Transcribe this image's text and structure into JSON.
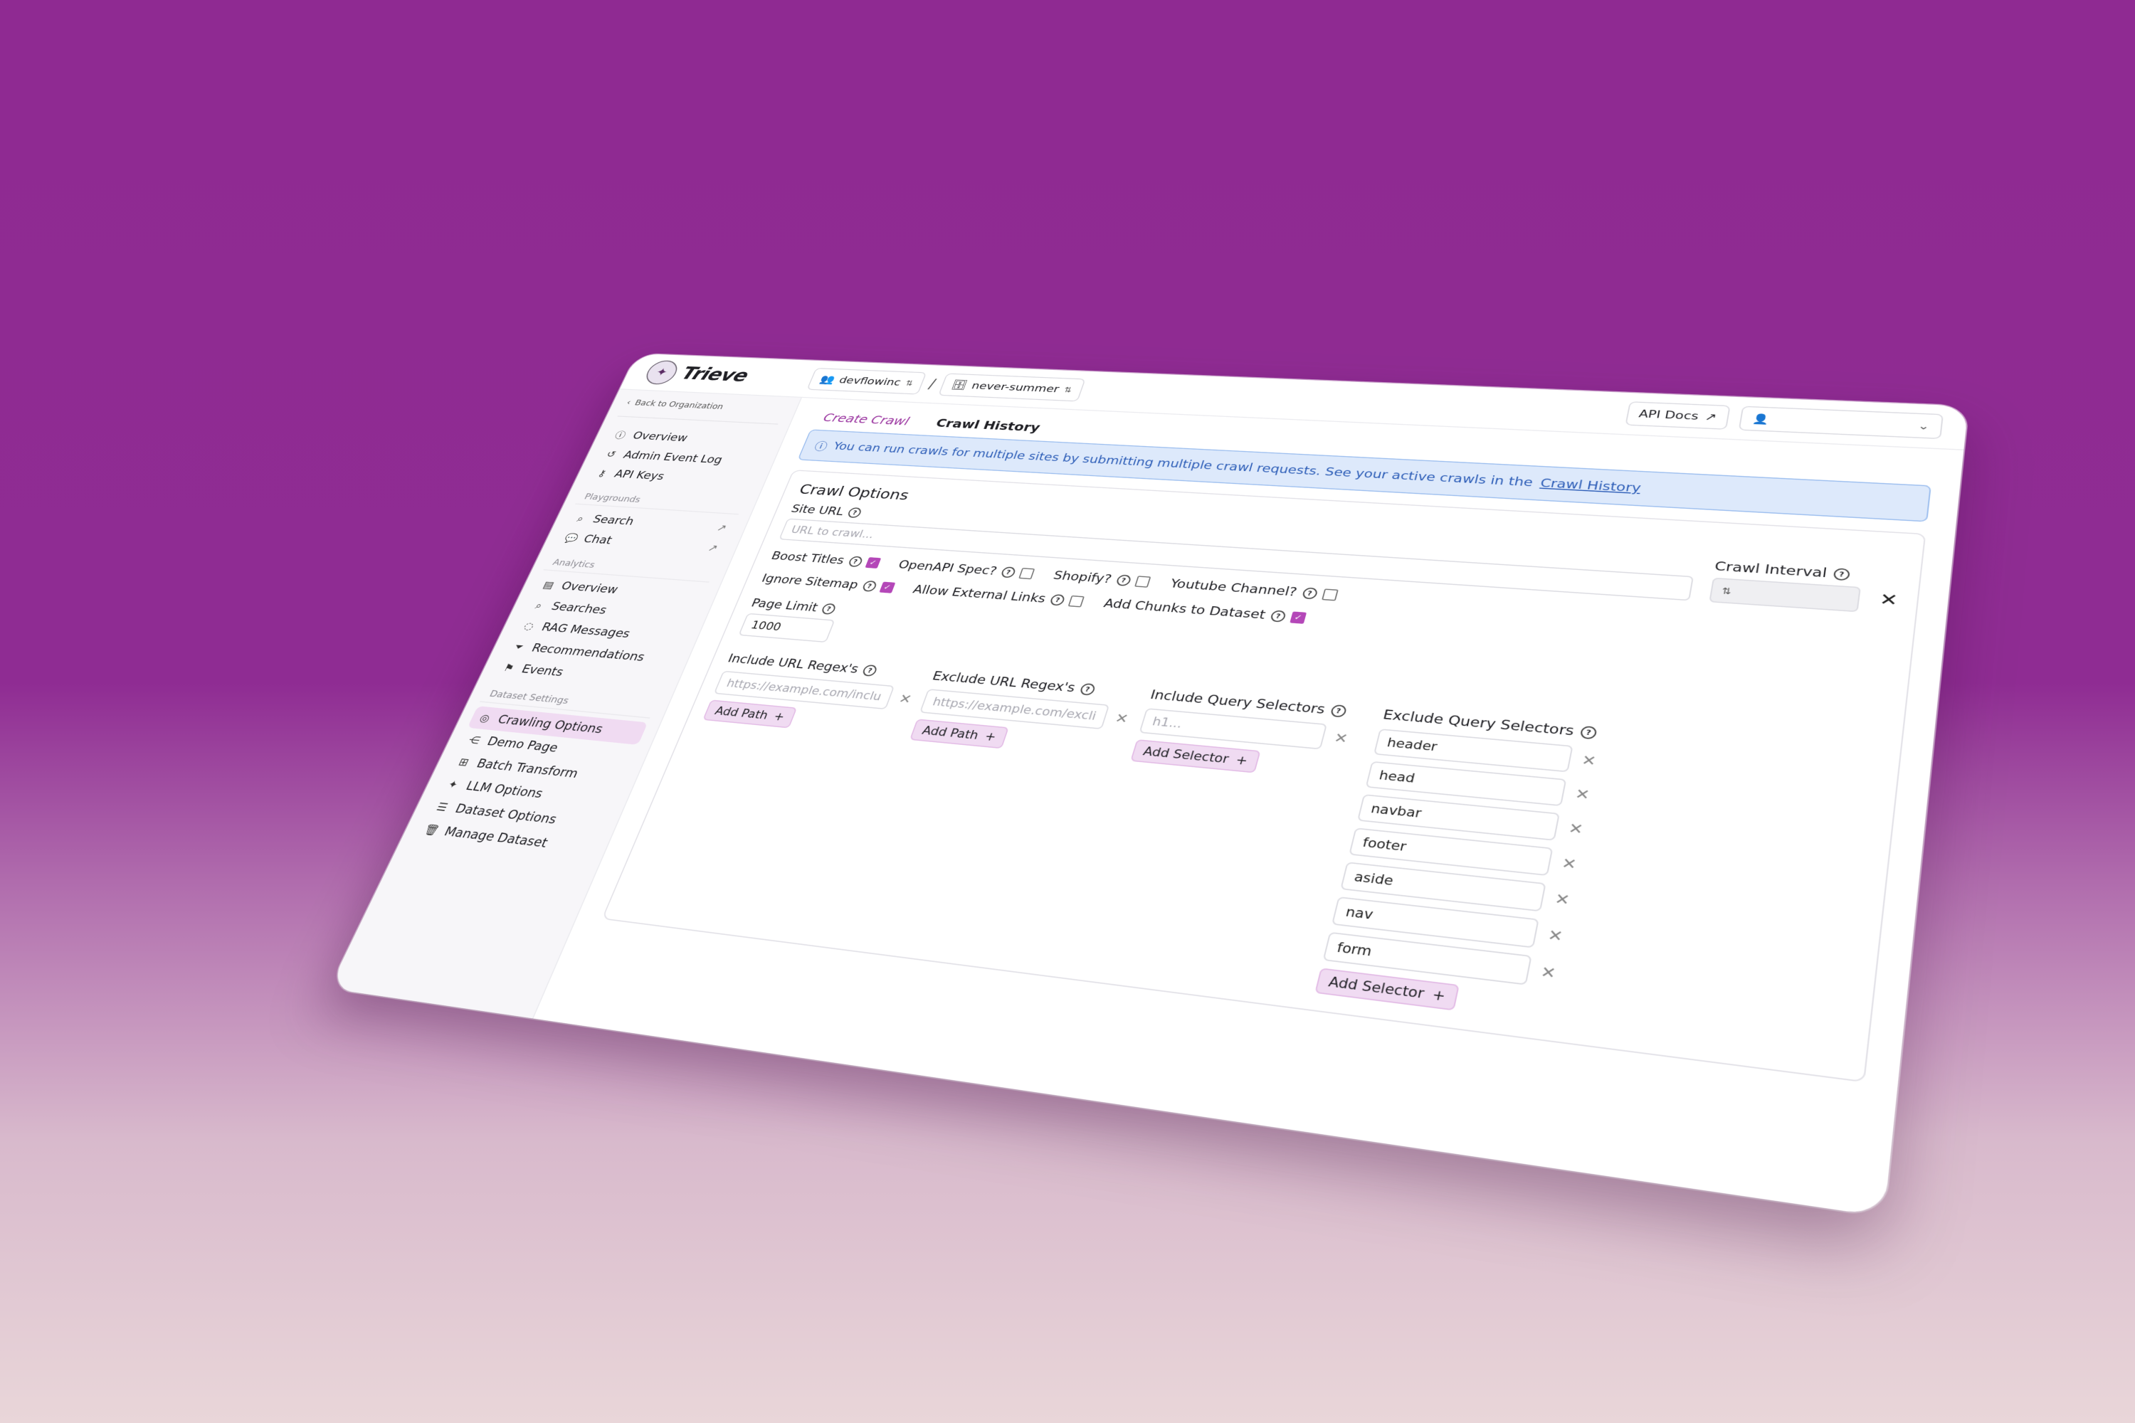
{
  "app": {
    "name": "Trieve"
  },
  "header": {
    "org": "devflowinc",
    "separator": "/",
    "dataset": "never-summer",
    "api_docs": "API Docs"
  },
  "sidebar": {
    "back": "Back to Organization",
    "top": [
      {
        "label": "Overview",
        "icon": "info-icon"
      },
      {
        "label": "Admin Event Log",
        "icon": "history-icon"
      },
      {
        "label": "API Keys",
        "icon": "key-icon"
      }
    ],
    "playgrounds": {
      "title": "Playgrounds",
      "items": [
        {
          "label": "Search",
          "icon": "search-icon"
        },
        {
          "label": "Chat",
          "icon": "chat-icon"
        }
      ]
    },
    "analytics": {
      "title": "Analytics",
      "items": [
        {
          "label": "Overview",
          "icon": "chart-icon"
        },
        {
          "label": "Searches",
          "icon": "search-icon"
        },
        {
          "label": "RAG Messages",
          "icon": "message-icon"
        },
        {
          "label": "Recommendations",
          "icon": "funnel-icon"
        },
        {
          "label": "Events",
          "icon": "events-icon"
        }
      ]
    },
    "dataset_settings": {
      "title": "Dataset Settings",
      "items": [
        {
          "label": "Crawling Options",
          "icon": "camera-icon"
        },
        {
          "label": "Demo Page",
          "icon": "share-icon"
        },
        {
          "label": "Batch Transform",
          "icon": "grid-icon"
        },
        {
          "label": "LLM Options",
          "icon": "sparkle-icon"
        },
        {
          "label": "Dataset Options",
          "icon": "sliders-icon"
        },
        {
          "label": "Manage Dataset",
          "icon": "trash-icon"
        }
      ]
    }
  },
  "tabs": {
    "create": "Create Crawl",
    "history": "Crawl History"
  },
  "banner": {
    "text": "You can run crawls for multiple sites by submitting multiple crawl requests. See your active crawls in the",
    "link": "Crawl History"
  },
  "form": {
    "title": "Crawl Options",
    "site_url": {
      "label": "Site URL",
      "placeholder": "URL to crawl..."
    },
    "crawl_interval": {
      "label": "Crawl Interval"
    },
    "checks_row1": [
      {
        "label": "Boost Titles",
        "checked": true
      },
      {
        "label": "OpenAPI Spec?",
        "checked": false
      },
      {
        "label": "Shopify?",
        "checked": false
      },
      {
        "label": "Youtube Channel?",
        "checked": false
      }
    ],
    "checks_row2": [
      {
        "label": "Ignore Sitemap",
        "checked": true
      },
      {
        "label": "Allow External Links",
        "checked": false
      },
      {
        "label": "Add Chunks to Dataset",
        "checked": true
      }
    ],
    "page_limit": {
      "label": "Page Limit",
      "value": "1000"
    },
    "include_url": {
      "label": "Include URL Regex's",
      "placeholder": "https://example.com/inclu",
      "button": "Add Path"
    },
    "exclude_url": {
      "label": "Exclude URL Regex's",
      "placeholder": "https://example.com/excli",
      "button": "Add Path"
    },
    "include_qs": {
      "label": "Include Query Selectors",
      "placeholder": "h1...",
      "button": "Add Selector"
    },
    "exclude_qs": {
      "label": "Exclude Query Selectors",
      "values": [
        "header",
        "head",
        "navbar",
        "footer",
        "aside",
        "nav",
        "form"
      ],
      "button": "Add Selector"
    }
  }
}
